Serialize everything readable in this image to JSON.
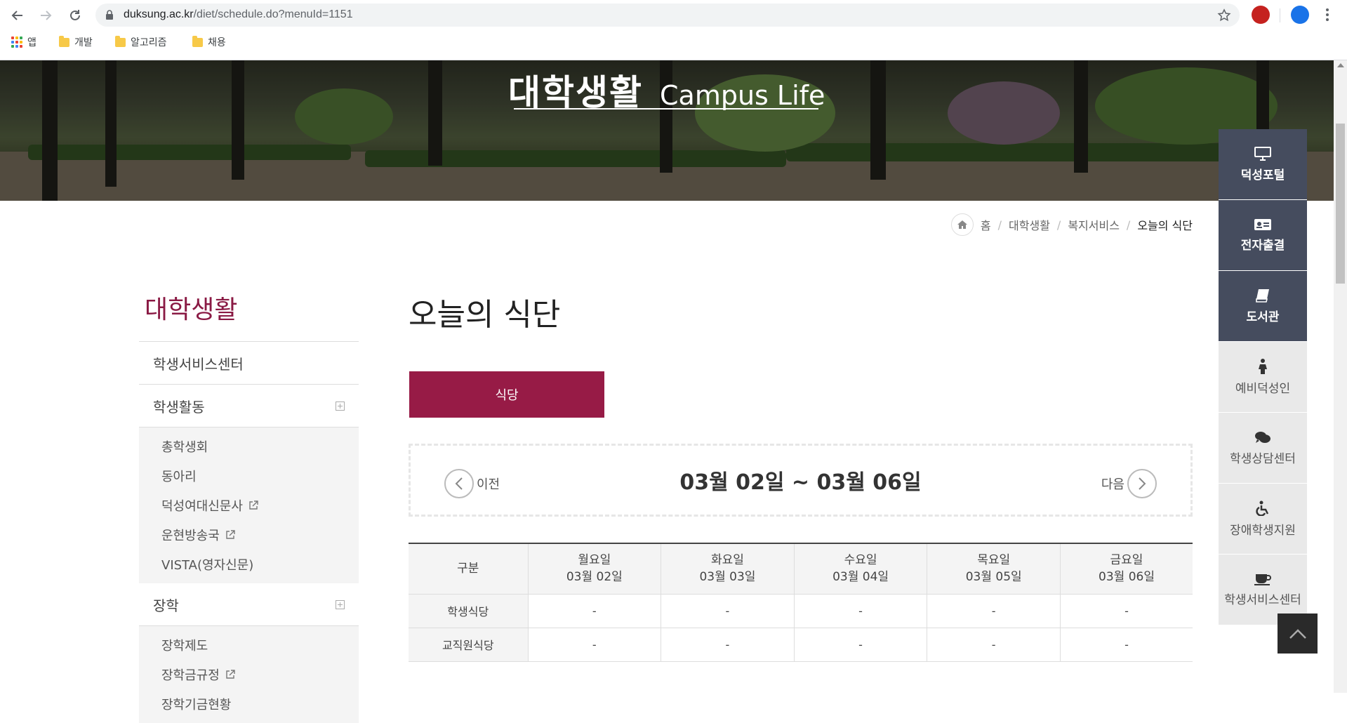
{
  "browser": {
    "url_host": "duksung.ac.kr",
    "url_path": "/diet/schedule.do?menuId=1151",
    "bookmarks": [
      "앱",
      "개발",
      "알고리즘",
      "채용"
    ]
  },
  "hero": {
    "title_ko": "대학생활",
    "title_en": "Campus Life"
  },
  "breadcrumb": [
    "홈",
    "대학생활",
    "복지서비스",
    "오늘의 식단"
  ],
  "sidebar": {
    "title": "대학생활",
    "items": [
      {
        "label": "학생서비스센터"
      },
      {
        "label": "학생활동",
        "sub": [
          "총학생회",
          "동아리",
          "덕성여대신문사",
          "운현방송국",
          "VISTA(영자신문)"
        ]
      },
      {
        "label": "장학",
        "sub": [
          "장학제도",
          "장학금규정",
          "장학기금현황"
        ]
      }
    ]
  },
  "main": {
    "title": "오늘의 식단",
    "tab_label": "식당",
    "week": {
      "prev_label": "이전",
      "next_label": "다음",
      "range": "03월 02일 ~ 03월 06일"
    },
    "table": {
      "corner": "구분",
      "days": [
        {
          "name": "월요일",
          "date": "03월 02일"
        },
        {
          "name": "화요일",
          "date": "03월 03일"
        },
        {
          "name": "수요일",
          "date": "03월 04일"
        },
        {
          "name": "목요일",
          "date": "03월 05일"
        },
        {
          "name": "금요일",
          "date": "03월 06일"
        }
      ],
      "rows": [
        {
          "label": "학생식당",
          "cells": [
            "-",
            "-",
            "-",
            "-",
            "-"
          ]
        },
        {
          "label": "교직원식당",
          "cells": [
            "-",
            "-",
            "-",
            "-",
            "-"
          ]
        }
      ]
    }
  },
  "quick_menu": [
    {
      "label": "덕성포털",
      "icon": "monitor-icon"
    },
    {
      "label": "전자출결",
      "icon": "id-card-icon"
    },
    {
      "label": "도서관",
      "icon": "book-icon"
    },
    {
      "label": "예비덕성인",
      "icon": "person-icon"
    },
    {
      "label": "학생상담센터",
      "icon": "chat-icon"
    },
    {
      "label": "장애학생지원",
      "icon": "wheelchair-icon"
    },
    {
      "label": "학생서비스센터",
      "icon": "cup-icon"
    }
  ],
  "colors": {
    "brand": "#971b46",
    "sidebar_title": "#8a1a44",
    "quick_dark": "#454c5e",
    "quick_light": "#e9e9e9"
  }
}
